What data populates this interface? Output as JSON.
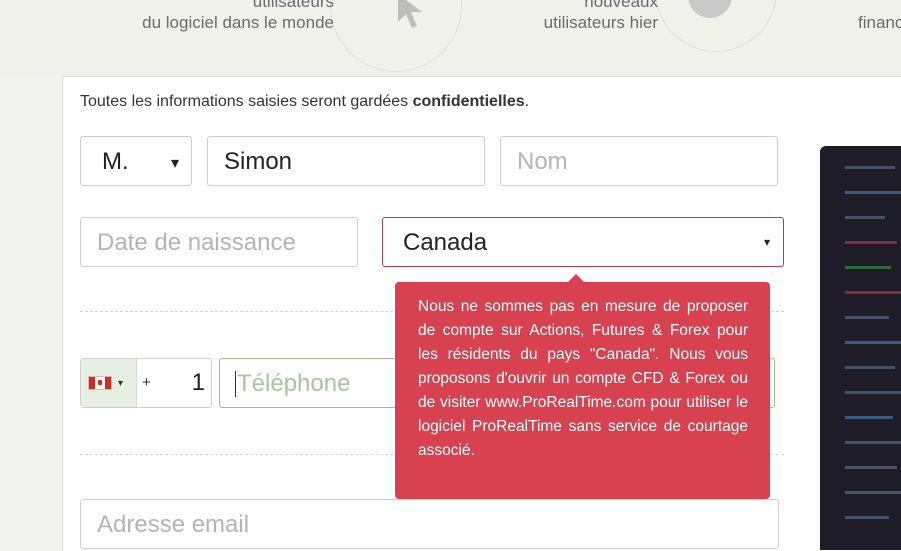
{
  "stats": {
    "stat1_line1": "utilisateurs",
    "stat1_line2": "du logiciel dans le monde",
    "stat2_line1": "nouveaux",
    "stat2_line2": "utilisateurs hier",
    "stat3_partial": "financ"
  },
  "form": {
    "confidential_prefix": "Toutes les informations saisies seront gardées ",
    "confidential_bold": "confidentielles",
    "confidential_suffix": ".",
    "title_select_value": "M.",
    "first_name_value": "Simon",
    "last_name_placeholder": "Nom",
    "birthdate_placeholder": "Date de naissance",
    "country_value": "Canada",
    "phone_plus": "+",
    "phone_dial_code": "1",
    "phone_placeholder": "Téléphone",
    "email_placeholder": "Adresse email"
  },
  "tooltip": {
    "message": "Nous ne sommes pas en mesure de proposer de compte sur Actions, Futures & Forex pour les résidents du pays \"Canada\". Nous vous proposons d'ouvrir un compte CFD & Forex ou de visiter www.ProRealTime.com pour utiliser le logiciel ProRealTime sans service de courtage associé."
  },
  "icons": {
    "caret": "▾",
    "flag": "canada-flag-icon"
  },
  "colors": {
    "error_red": "#d84150",
    "phone_focus_border": "#9cc08f",
    "country_border": "#b04050"
  }
}
